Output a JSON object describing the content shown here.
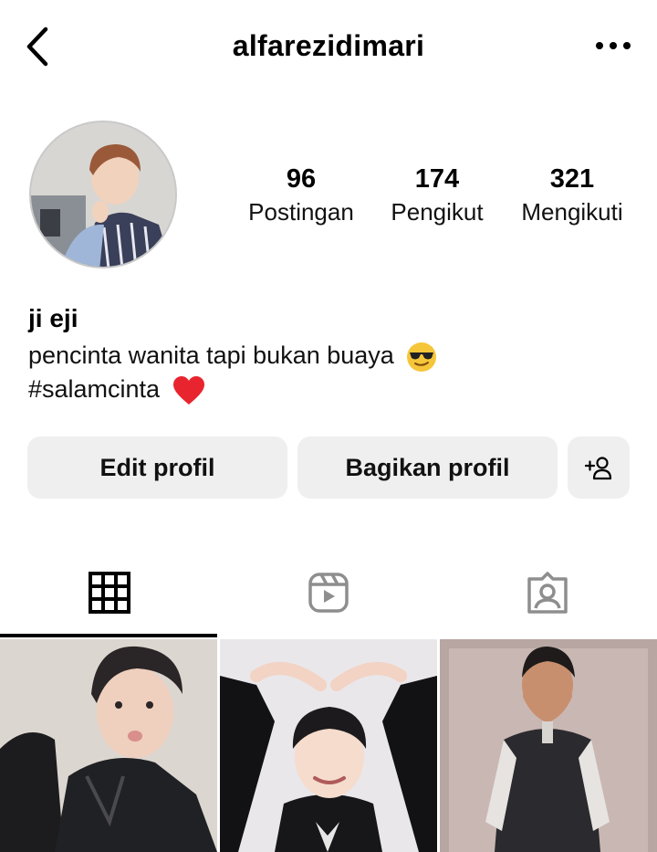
{
  "header": {
    "username": "alfarezidimari"
  },
  "profile": {
    "stats": [
      {
        "value": "96",
        "label": "Postingan"
      },
      {
        "value": "174",
        "label": "Pengikut"
      },
      {
        "value": "321",
        "label": "Mengikuti"
      }
    ],
    "name": "ji eji",
    "bio_line1": "pencinta wanita tapi bukan buaya",
    "bio_line2": "#salamcinta"
  },
  "actions": {
    "edit_label": "Edit profil",
    "share_label": "Bagikan profil"
  },
  "tabs": [
    {
      "icon": "grid-icon",
      "active": true
    },
    {
      "icon": "reels-icon",
      "active": false
    },
    {
      "icon": "tagged-icon",
      "active": false
    }
  ],
  "colors": {
    "button_bg": "#efefef",
    "text": "#000000",
    "icon_muted": "#8e8e8e"
  }
}
